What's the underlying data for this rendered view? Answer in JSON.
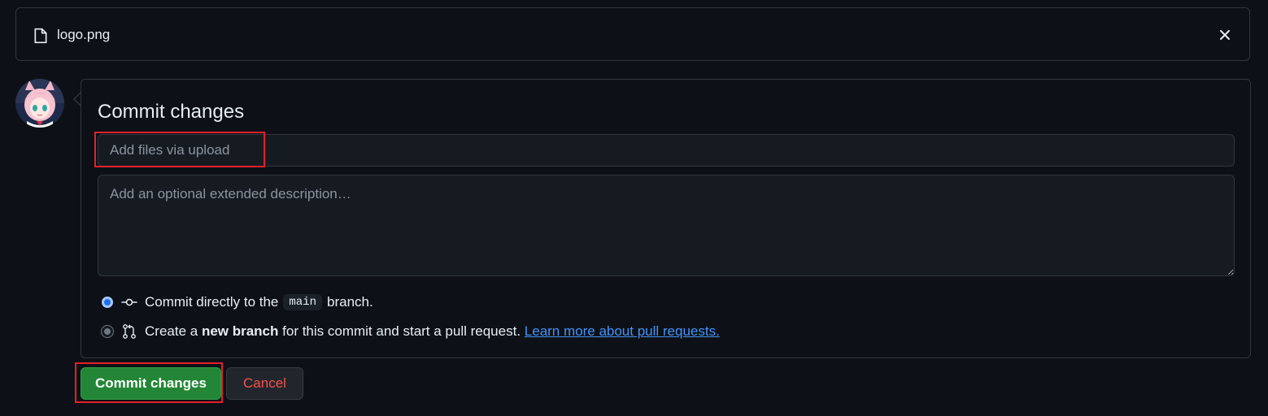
{
  "file": {
    "name": "logo.png",
    "icon": "file-icon",
    "close_icon": "close-icon"
  },
  "commit": {
    "title": "Commit changes",
    "summary_placeholder": "Add files via upload",
    "description_placeholder": "Add an optional extended description…",
    "options": {
      "direct": {
        "before": "Commit directly to the",
        "branch": "main",
        "after": "branch.",
        "selected": true
      },
      "new_branch": {
        "before": "Create a",
        "bold": "new branch",
        "after": "for this commit and start a pull request.",
        "link": "Learn more about pull requests.",
        "selected": false
      }
    }
  },
  "buttons": {
    "commit": "Commit changes",
    "cancel": "Cancel"
  },
  "colors": {
    "background": "#0d1117",
    "primary_button": "#238636",
    "cancel_text": "#f85149",
    "link": "#4493f8",
    "highlight": "#e5202b"
  }
}
